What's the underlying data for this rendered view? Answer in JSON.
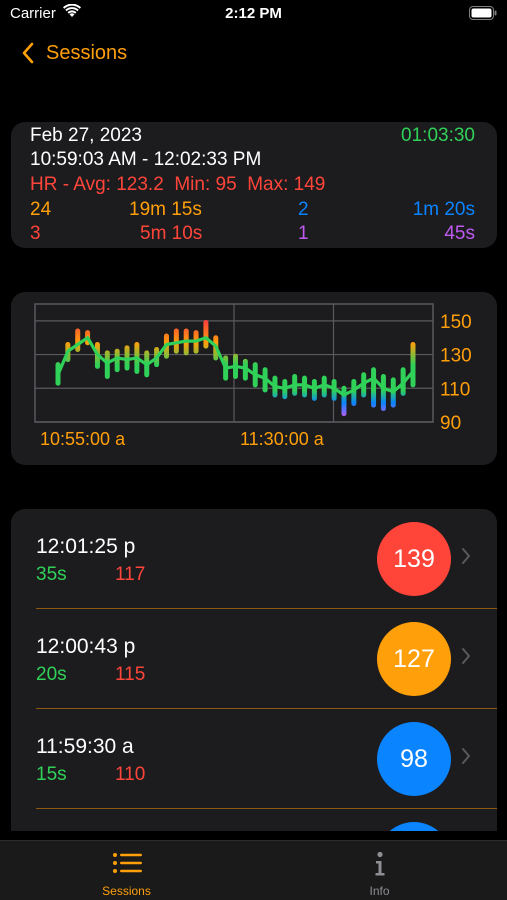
{
  "status_bar": {
    "carrier": "Carrier",
    "time": "2:12 PM"
  },
  "nav": {
    "back_label": "Sessions"
  },
  "summary": {
    "date": "Feb 27, 2023",
    "total_duration": "01:03:30",
    "time_range": "10:59:03 AM - 12:02:33 PM",
    "hr_stats": "HR - Avg: 123.2  Min: 95  Max: 149",
    "rows": [
      {
        "count": "24",
        "duration": "19m 15s",
        "count2": "2",
        "duration2": "1m 20s"
      },
      {
        "count": "3",
        "duration": "5m 10s",
        "count2": "1",
        "duration2": "45s"
      }
    ]
  },
  "chart_data": {
    "type": "line",
    "x_tick_labels": [
      "10:55:00 a",
      "11:30:00 a"
    ],
    "y_tick_labels": [
      "150",
      "130",
      "110",
      "90"
    ],
    "ylim": [
      90,
      160
    ],
    "grid": true,
    "series": [
      {
        "values": [
          118,
          132,
          136,
          140,
          130,
          125,
          128,
          127,
          128,
          124,
          128,
          136,
          137,
          138,
          138,
          140,
          135,
          122,
          123,
          122,
          118,
          116,
          111,
          110,
          112,
          112,
          110,
          112,
          110,
          106,
          109,
          113,
          116,
          110,
          108,
          113,
          120
        ],
        "range_low": [
          113,
          127,
          133,
          137,
          123,
          117,
          121,
          122,
          120,
          118,
          124,
          129,
          132,
          131,
          132,
          135,
          128,
          116,
          117,
          116,
          112,
          109,
          106,
          105,
          107,
          106,
          104,
          106,
          104,
          95,
          101,
          106,
          100,
          98,
          100,
          107,
          112
        ],
        "range_high": [
          124,
          136,
          144,
          143,
          136,
          131,
          132,
          134,
          136,
          131,
          133,
          141,
          144,
          144,
          143,
          149,
          140,
          128,
          129,
          126,
          124,
          121,
          116,
          114,
          117,
          116,
          114,
          116,
          114,
          110,
          114,
          118,
          121,
          117,
          115,
          121,
          136
        ]
      }
    ]
  },
  "sessions": [
    {
      "time": "12:01:25 p",
      "duration": "35s",
      "min_hr": "117",
      "hr": "139",
      "color": "#ff453a"
    },
    {
      "time": "12:00:43 p",
      "duration": "20s",
      "min_hr": "115",
      "hr": "127",
      "color": "#ff9f0a"
    },
    {
      "time": "11:59:30 a",
      "duration": "15s",
      "min_hr": "110",
      "hr": "98",
      "color": "#0a84ff"
    },
    {
      "time": "",
      "duration": "",
      "min_hr": "",
      "hr": "",
      "color": "#0a84ff"
    }
  ],
  "tabs": [
    {
      "label": "Sessions",
      "icon": "list-icon",
      "active": true
    },
    {
      "label": "Info",
      "icon": "info-icon",
      "active": false
    }
  ],
  "colors": {
    "accent": "#ff9f0a",
    "green": "#30d158",
    "red": "#ff453a",
    "blue": "#0a84ff",
    "purple": "#bf5af2"
  }
}
